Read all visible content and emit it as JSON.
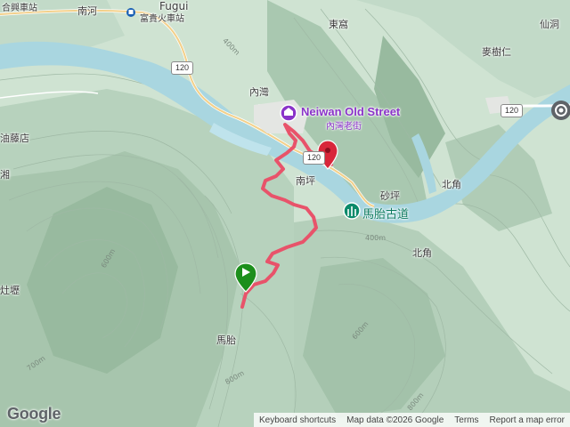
{
  "colors": {
    "river": "#a9d6e0",
    "track": "#e8536a",
    "poi": "#8a33c9",
    "trail_poi": "#0b8a6a",
    "start": "#1c8f1c",
    "end": "#d8263a"
  },
  "labels": {
    "nanhe": "南河",
    "fugui": "Fugui",
    "fugui_station": "富貴火車站",
    "hexing": "合興車站",
    "dongwo": "東窩",
    "xiandong": "仙洞",
    "maishuren": "麥樹仁",
    "neiwan": "內灣",
    "youtengdian": "油藤店",
    "nanping": "南坪",
    "shaping": "砂坪",
    "beijiao1": "北角",
    "beijiao2": "北角",
    "matai": "馬胎",
    "zaoba": "灶壢",
    "xiang": "湘"
  },
  "pois": {
    "neiwan_en": "Neiwan Old Street",
    "neiwan_zh": "內灣老街",
    "trail": "馬胎古道"
  },
  "roads": {
    "r120a": "120",
    "r120b": "120",
    "r120c": "120"
  },
  "contours": {
    "c400": "400m",
    "c400b": "400m",
    "c600": "600m",
    "c600b": "600m",
    "c700": "700m",
    "c800": "800m",
    "c800b": "800m"
  },
  "map_ui": {
    "logo": "Google",
    "keyboard": "Keyboard shortcuts",
    "mapdata": "Map data ©2026 Google",
    "terms": "Terms",
    "report": "Report a map error"
  }
}
